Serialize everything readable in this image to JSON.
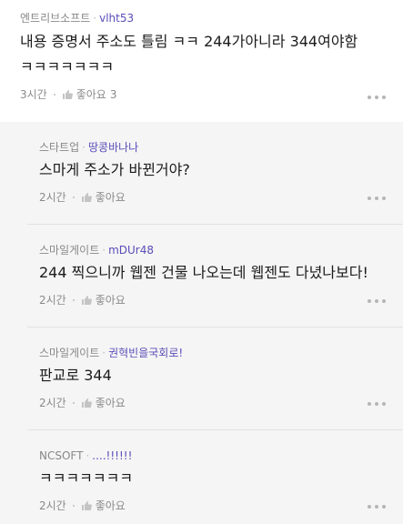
{
  "top_comment": {
    "company": "엔트리브소프트",
    "nickname": "vlht53",
    "line1": "내용 증명서 주소도 틀림 ㅋㅋ 244가아니라 344여야함",
    "line2": "ㅋㅋㅋㅋㅋㅋㅋ",
    "time": "3시간",
    "like_label": "좋아요",
    "like_count": "3"
  },
  "replies": [
    {
      "company": "스타트업",
      "nickname": "땅콩바나나",
      "text": "스마게 주소가 바뀐거야?",
      "time": "2시간",
      "like_label": "좋아요"
    },
    {
      "company": "스마일게이트",
      "nickname": "mDUr48",
      "text": "244 찍으니까 웹젠 건물 나오는데 웹젠도 다녔나보다!",
      "time": "2시간",
      "like_label": "좋아요"
    },
    {
      "company": "스마일게이트",
      "nickname": "권혁빈을국회로!",
      "text": "판교로 344",
      "time": "2시간",
      "like_label": "좋아요"
    },
    {
      "company": "NCSOFT",
      "nickname": "....!!!!!!",
      "text": "ㅋㅋㅋㅋㅋㅋㅋ",
      "time": "2시간",
      "like_label": "좋아요"
    }
  ],
  "icons": {
    "like": "thumbs-up-icon",
    "more": "more-options-icon"
  },
  "colors": {
    "nickname": "#5a4db8",
    "reply_background": "#f5f5f5",
    "meta_gray": "#888888"
  }
}
